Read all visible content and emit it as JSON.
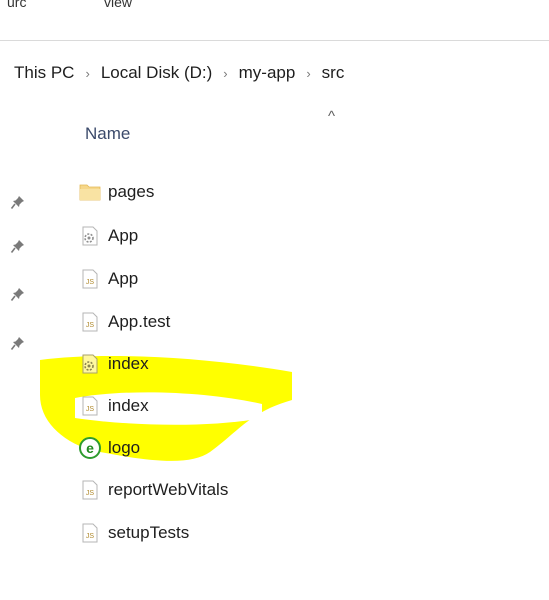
{
  "ribbon": {
    "tab_left": "urc",
    "tab_right": "view"
  },
  "breadcrumb": [
    "This PC",
    "Local Disk (D:)",
    "my-app",
    "src"
  ],
  "list_header": {
    "name": "Name",
    "sort_indicator": "^"
  },
  "pinned_icon": "pin-icon",
  "files": [
    {
      "name": "pages",
      "icon": "folder-icon"
    },
    {
      "name": "App",
      "icon": "css-file-icon"
    },
    {
      "name": "App",
      "icon": "js-file-icon"
    },
    {
      "name": "App.test",
      "icon": "js-file-icon"
    },
    {
      "name": "index",
      "icon": "css-file-icon"
    },
    {
      "name": "index",
      "icon": "js-file-icon"
    },
    {
      "name": "logo",
      "icon": "svg-file-icon"
    },
    {
      "name": "reportWebVitals",
      "icon": "js-file-icon"
    },
    {
      "name": "setupTests",
      "icon": "js-file-icon"
    }
  ],
  "colors": {
    "highlight": "#ffff00",
    "folder": "#f6d78a"
  }
}
